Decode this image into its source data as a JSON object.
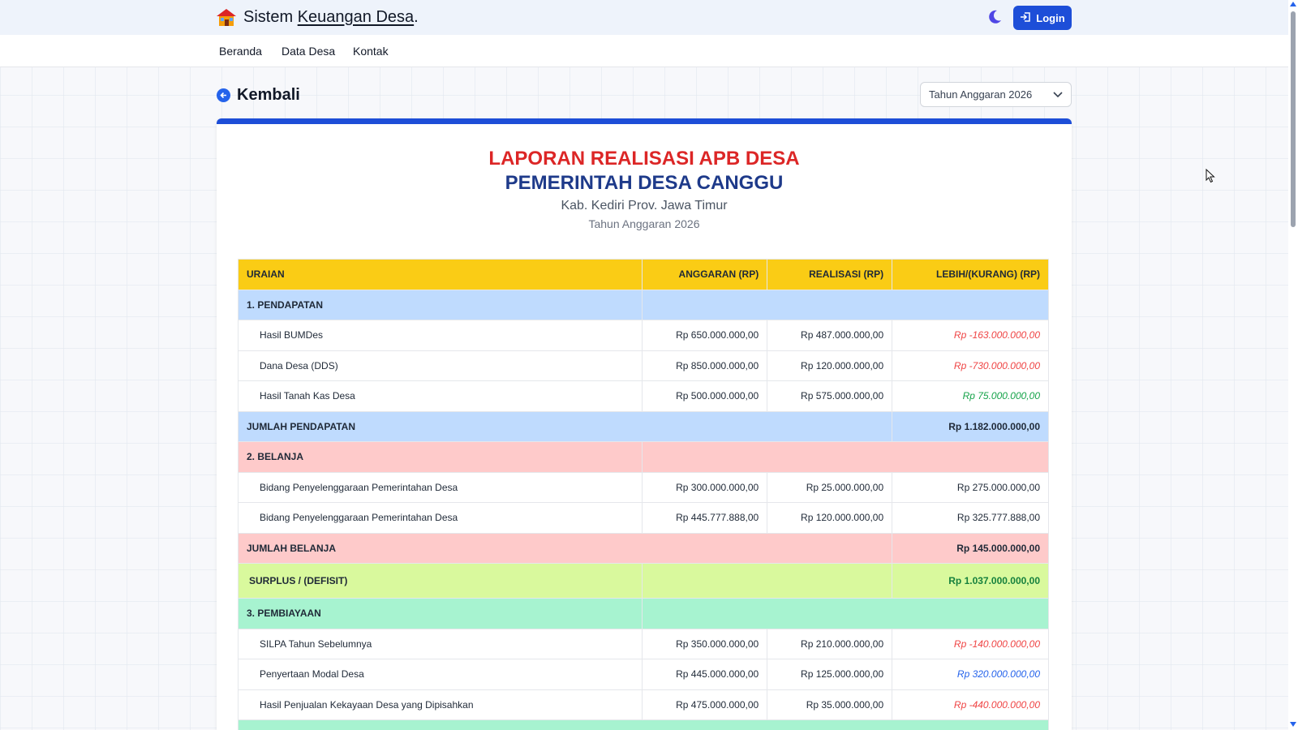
{
  "header": {
    "brand_prefix": "Sistem",
    "brand_underlined": "Keuangan Desa",
    "brand_suffix": ".",
    "login_label": "Login",
    "brand_icon": "house-icon",
    "theme_icon": "moon-icon"
  },
  "nav": {
    "items": [
      "Beranda",
      "Data Desa",
      "Kontak"
    ]
  },
  "toolbar": {
    "back_label": "Kembali",
    "year_selected": "Tahun Anggaran 2026"
  },
  "report": {
    "title": "LAPORAN REALISASI APB DESA",
    "subtitle": "PEMERINTAH DESA CANGGU",
    "region": "Kab. Kediri Prov. Jawa Timur",
    "year": "Tahun Anggaran 2026"
  },
  "table": {
    "headers": [
      "URAIAN",
      "ANGGARAN (RP)",
      "REALISASI (RP)",
      "LEBIH/(KURANG) (RP)"
    ],
    "pendapatan_label": "1. PENDAPATAN",
    "pendapatan": [
      {
        "name": "Hasil BUMDes",
        "anggaran": "Rp 650.000.000,00",
        "realisasi": "Rp 487.000.000,00",
        "selisih": "Rp -163.000.000,00"
      },
      {
        "name": "Dana Desa (DDS)",
        "anggaran": "Rp 850.000.000,00",
        "realisasi": "Rp 120.000.000,00",
        "selisih": "Rp -730.000.000,00"
      },
      {
        "name": "Hasil Tanah Kas Desa",
        "anggaran": "Rp 500.000.000,00",
        "realisasi": "Rp 575.000.000,00",
        "selisih": "Rp 75.000.000,00"
      }
    ],
    "jumlah_pendapatan_label": "JUMLAH PENDAPATAN",
    "jumlah_pendapatan": "Rp 1.182.000.000,00",
    "belanja_label": "2. BELANJA",
    "belanja": [
      {
        "name": "Bidang Penyelenggaraan Pemerintahan Desa",
        "anggaran": "Rp 300.000.000,00",
        "realisasi": "Rp 25.000.000,00",
        "selisih": "Rp 275.000.000,00"
      },
      {
        "name": "Bidang Penyelenggaraan Pemerintahan Desa",
        "anggaran": "Rp 445.777.888,00",
        "realisasi": "Rp 120.000.000,00",
        "selisih": "Rp 325.777.888,00"
      }
    ],
    "jumlah_belanja_label": "JUMLAH BELANJA",
    "jumlah_belanja": "Rp 145.000.000,00",
    "surplus_label": "SURPLUS / (DEFISIT)",
    "surplus": "Rp 1.037.000.000,00",
    "pembiayaan_label": "3. PEMBIAYAAN",
    "pembiayaan": [
      {
        "name": "SILPA Tahun Sebelumnya",
        "anggaran": "Rp 350.000.000,00",
        "realisasi": "Rp 210.000.000,00",
        "selisih": "Rp -140.000.000,00"
      },
      {
        "name": "Penyertaan Modal Desa",
        "anggaran": "Rp 445.000.000,00",
        "realisasi": "Rp 125.000.000,00",
        "selisih": "Rp 320.000.000,00"
      },
      {
        "name": "Hasil Penjualan Kekayaan Desa yang Dipisahkan",
        "anggaran": "Rp 475.000.000,00",
        "realisasi": "Rp 35.000.000,00",
        "selisih": "Rp -440.000.000,00"
      }
    ]
  },
  "colors": {
    "accent": "#1d4ed8",
    "header_row": "#facc15",
    "negative": "#ef4444",
    "positive": "#16a34a"
  }
}
